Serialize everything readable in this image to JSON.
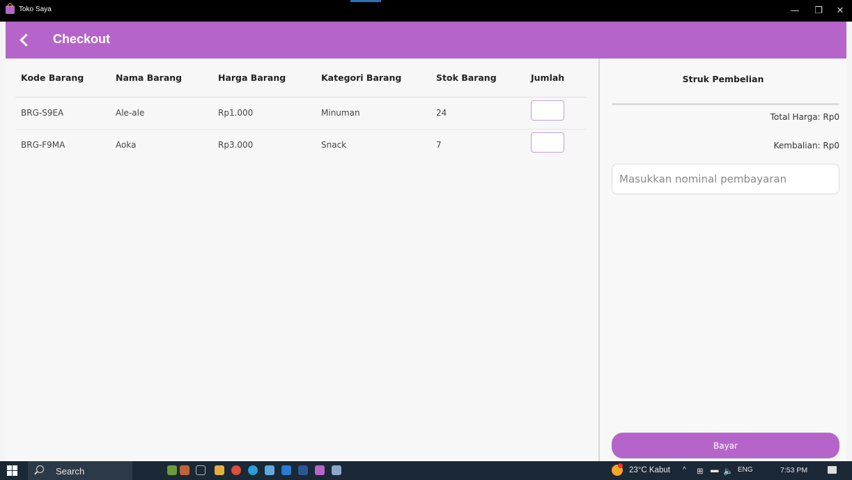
{
  "window": {
    "title": "Toko Saya",
    "controls": {
      "minimize": "—",
      "maximize": "❐",
      "close": "✕"
    }
  },
  "header": {
    "title": "Checkout",
    "back_icon": "back-arrow-icon"
  },
  "table": {
    "columns": [
      "Kode Barang",
      "Nama Barang",
      "Harga Barang",
      "Kategori Barang",
      "Stok Barang",
      "Jumlah"
    ],
    "rows": [
      {
        "kode": "BRG-S9EA",
        "nama": "Ale-ale",
        "harga": "Rp1.000",
        "kategori": "Minuman",
        "stok": "24",
        "jumlah": ""
      },
      {
        "kode": "BRG-F9MA",
        "nama": "Aoka",
        "harga": "Rp3.000",
        "kategori": "Snack",
        "stok": "7",
        "jumlah": ""
      }
    ]
  },
  "receipt": {
    "title": "Struk Pembelian",
    "total": "Total Harga: Rp0",
    "change": "Kembalian: Rp0",
    "payment_value": "",
    "payment_placeholder": "Masukkan nominal pembayaran",
    "pay_button": "Bayar"
  },
  "taskbar": {
    "search_label": "Search",
    "weather": "23°C  Kabut",
    "language": "ENG",
    "time": "7:53 PM"
  },
  "colors": {
    "accent": "#b565c9",
    "titlebar": "#000000",
    "taskbar": "#1b2836"
  }
}
